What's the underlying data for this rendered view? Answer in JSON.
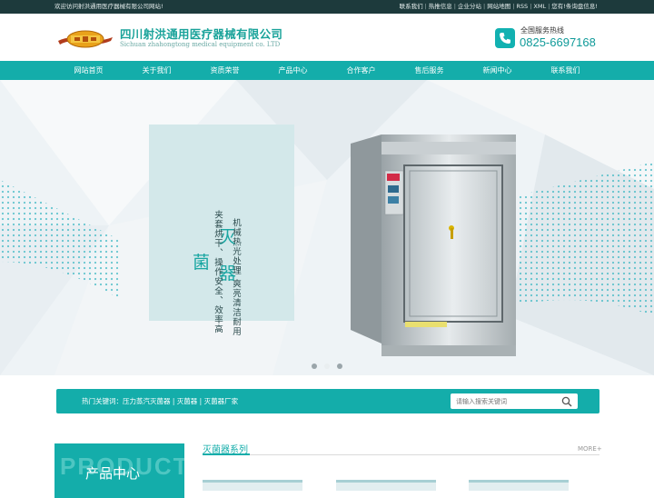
{
  "topbar": {
    "welcome": "欢迎访问射洪通用医疗器械有限公司网站!",
    "links": [
      "联系我们",
      "热推信息",
      "企业分站",
      "网站地图",
      "RSS",
      "XML"
    ],
    "notice": "您有!条询盘信息!"
  },
  "header": {
    "company_cn": "四川射洪通用医疗器械有限公司",
    "company_en": "Sichuan zhahongtong medical equipment co. LTD",
    "hotline_title": "全国服务热线",
    "hotline_number": "0825-6697168"
  },
  "nav": {
    "items": [
      "网站首页",
      "关于我们",
      "资质荣誉",
      "产品中心",
      "合作客户",
      "售后服务",
      "新闻中心",
      "联系我们"
    ]
  },
  "banner": {
    "title_chars": [
      "灭",
      "菌",
      "器"
    ],
    "text_col1": "机械热光处理 爽亮清洁耐用",
    "text_col2": "夹套烘干、操作安全、效率高",
    "slides": 3,
    "active_slide": 2
  },
  "search": {
    "label": "热门关键词：",
    "keywords": [
      "压力蒸汽灭菌器",
      "灭菌器",
      "灭菌器厂家"
    ],
    "placeholder": "请输入搜索关键词"
  },
  "products": {
    "watermark": "PRODUCT",
    "title": "产品中心",
    "series_title": "灭菌器系列",
    "more": "MORE+"
  },
  "colors": {
    "accent": "#14adaa",
    "topbar": "#1d3a3c"
  }
}
